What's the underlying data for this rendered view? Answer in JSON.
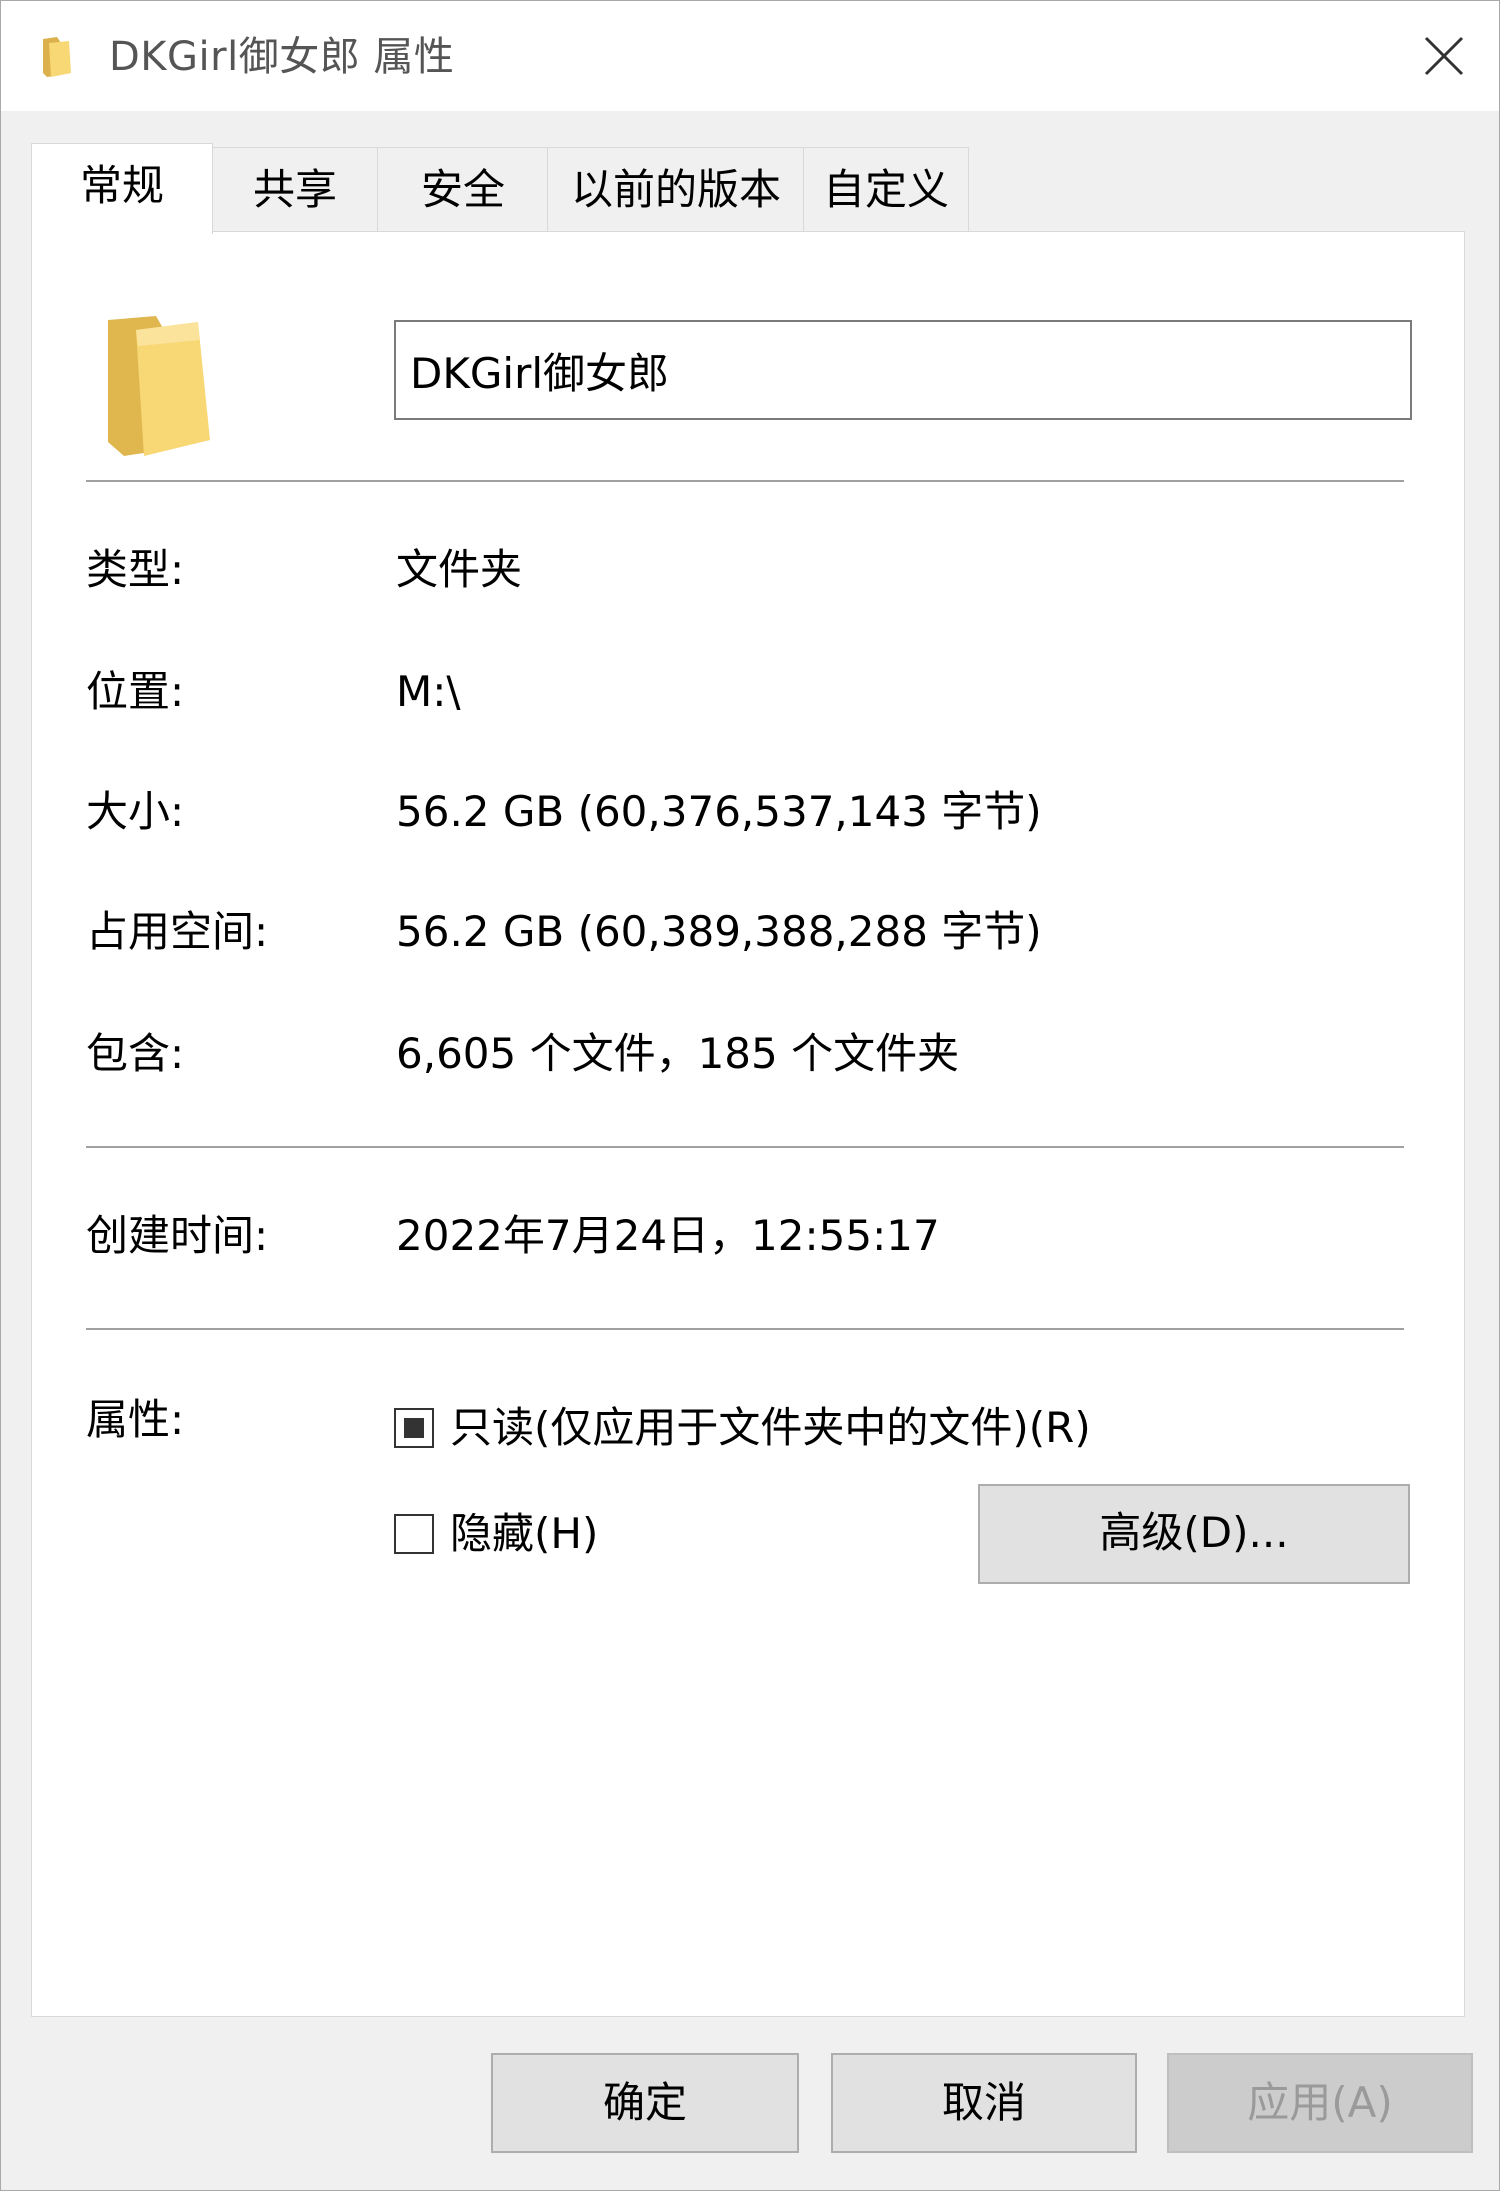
{
  "window": {
    "title": "DKGirl御女郎 属性",
    "folder_color": "#f8d775"
  },
  "tabs": [
    {
      "label": "常规",
      "active": true
    },
    {
      "label": "共享",
      "active": false
    },
    {
      "label": "安全",
      "active": false
    },
    {
      "label": "以前的版本",
      "active": false
    },
    {
      "label": "自定义",
      "active": false
    }
  ],
  "general": {
    "name_value": "DKGirl御女郎",
    "rows": [
      {
        "label": "类型:",
        "value": "文件夹"
      },
      {
        "label": "位置:",
        "value": "M:\\"
      },
      {
        "label": "大小:",
        "value": "56.2 GB (60,376,537,143 字节)"
      },
      {
        "label": "占用空间:",
        "value": "56.2 GB (60,389,388,288 字节)"
      },
      {
        "label": "包含:",
        "value": "6,605 个文件，185 个文件夹"
      }
    ],
    "created_label": "创建时间:",
    "created_value": "2022年7月24日，12:55:17",
    "attributes_label": "属性:",
    "readonly_label": "只读(仅应用于文件夹中的文件)(R)",
    "readonly_state": "indeterminate",
    "hidden_label": "隐藏(H)",
    "hidden_checked": false,
    "advanced_button": "高级(D)..."
  },
  "footer": {
    "ok": "确定",
    "cancel": "取消",
    "apply": "应用(A)",
    "apply_enabled": false
  }
}
